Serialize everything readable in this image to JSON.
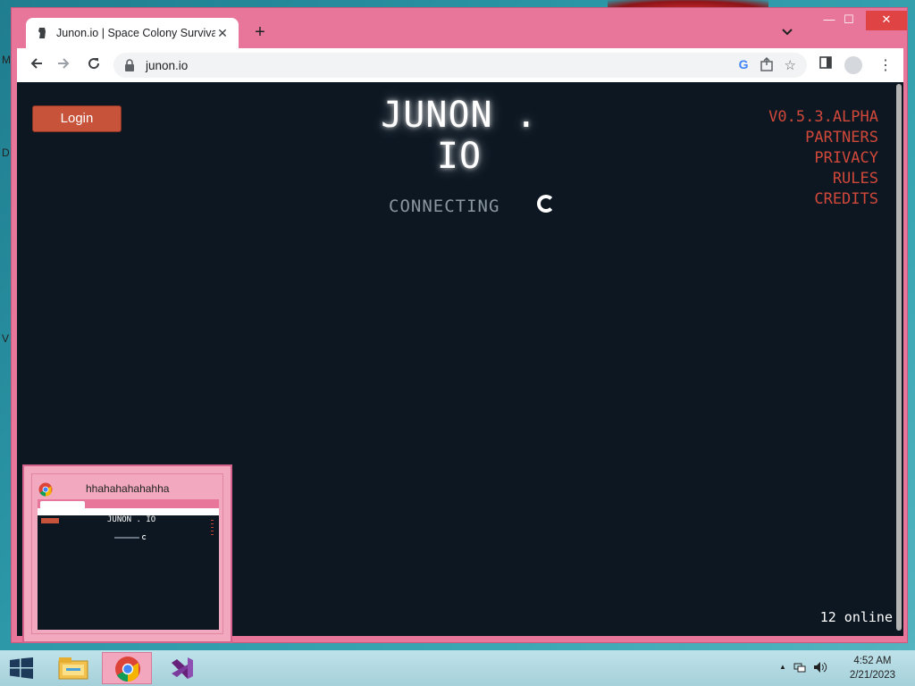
{
  "browser": {
    "tab_title": "Junon.io | Space Colony Survival",
    "tab_close": "✕",
    "new_tab": "+",
    "url": "junon.io",
    "window_min": "—",
    "window_max": "☐",
    "window_close": "✕"
  },
  "page": {
    "login_label": "Login",
    "title": "JUNON . IO",
    "version": "V0.5.3.ALPHA",
    "links": [
      "PARTNERS",
      "PRIVACY",
      "RULES",
      "CREDITS"
    ],
    "status": "CONNECTING",
    "online": "12 online"
  },
  "thumbnail": {
    "title": "hhahahahahahha",
    "mini_title": "JUNON . IO"
  },
  "desktop": {
    "letters": [
      "M",
      "D",
      "V"
    ]
  },
  "taskbar": {
    "time": "4:52 AM",
    "date": "2/21/2023",
    "tray_arrow": "▲"
  },
  "colors": {
    "page_bg": "#0c1722",
    "accent_red": "#d0483a",
    "login_bg": "#c6533a",
    "window_frame": "#e8769a"
  }
}
